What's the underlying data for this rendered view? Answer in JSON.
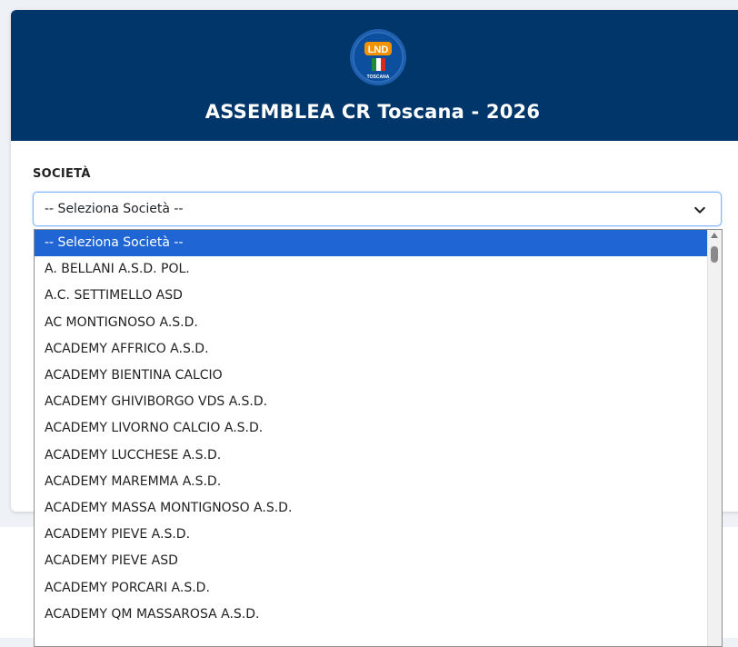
{
  "header": {
    "logo_text": "LND",
    "logo_subtext": "TOSCANA",
    "title": "ASSEMBLEA CR Toscana - 2026"
  },
  "form": {
    "societa_label": "SOCIETÀ",
    "select_value": "-- Seleziona Società --"
  },
  "dropdown": {
    "options": [
      {
        "label": "-- Seleziona Società --",
        "selected": true
      },
      {
        "label": "A. BELLANI A.S.D. POL."
      },
      {
        "label": "A.C. SETTIMELLO ASD"
      },
      {
        "label": "AC MONTIGNOSO A.S.D."
      },
      {
        "label": "ACADEMY AFFRICO A.S.D."
      },
      {
        "label": "ACADEMY BIENTINA CALCIO"
      },
      {
        "label": "ACADEMY GHIVIBORGO VDS A.S.D."
      },
      {
        "label": "ACADEMY LIVORNO CALCIO A.S.D."
      },
      {
        "label": "ACADEMY LUCCHESE A.S.D."
      },
      {
        "label": "ACADEMY MAREMMA A.S.D."
      },
      {
        "label": "ACADEMY MASSA MONTIGNOSO A.S.D."
      },
      {
        "label": "ACADEMY PIEVE A.S.D."
      },
      {
        "label": "ACADEMY PIEVE ASD"
      },
      {
        "label": "ACADEMY PORCARI A.S.D."
      },
      {
        "label": "ACADEMY QM MASSAROSA A.S.D."
      }
    ]
  },
  "colors": {
    "header_bg": "#01366b",
    "selected_option_bg": "#1f66d4",
    "select_focus_border": "#86b7fe"
  },
  "icons": {
    "logo": "lnd-toscana-logo",
    "select_arrow": "chevron-down-icon"
  }
}
